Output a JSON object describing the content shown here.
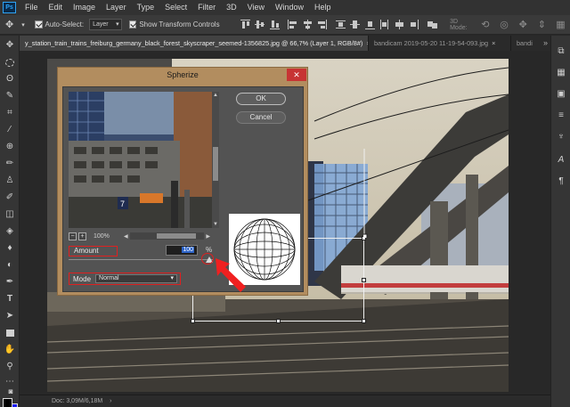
{
  "app": {
    "logo": "Ps"
  },
  "menu": [
    "File",
    "Edit",
    "Image",
    "Layer",
    "Type",
    "Select",
    "Filter",
    "3D",
    "View",
    "Window",
    "Help"
  ],
  "options": {
    "auto_select_label": "Auto-Select:",
    "auto_select_value": "Layer",
    "show_transform_label": "Show Transform Controls",
    "mode_3d_label": "3D Mode:"
  },
  "tabs": [
    {
      "label": "y_station_train_trains_freiburg_germany_black_forest_skyscraper_seemed-1356825.jpg @ 66,7% (Layer 1, RGB/8#)",
      "close": "×",
      "active": true
    },
    {
      "label": "bandicam 2019-05-20 11-19-54-093.jpg",
      "close": "×",
      "active": false
    },
    {
      "label": "bandi",
      "close": "",
      "active": false
    }
  ],
  "tabs_overflow": "»",
  "status": {
    "doc": "Doc: 3,09M/6,18M"
  },
  "dialog": {
    "title": "Spherize",
    "close": "✕",
    "ok_label": "OK",
    "cancel_label": "Cancel",
    "zoom_level": "100%",
    "zoom_out": "−",
    "zoom_in": "+",
    "amount_label": "Amount",
    "amount_value": "100",
    "amount_unit": "%",
    "amount_slider_fraction": 1.0,
    "mode_label": "Mode",
    "mode_value": "Normal"
  },
  "colors": {
    "dialog_frame": "#b28d5f",
    "highlight": "#e02020",
    "arrow": "#f02020",
    "foreground": "#000000",
    "background": "#1a1af0"
  },
  "preview_scene": {
    "platform_number": "7"
  }
}
